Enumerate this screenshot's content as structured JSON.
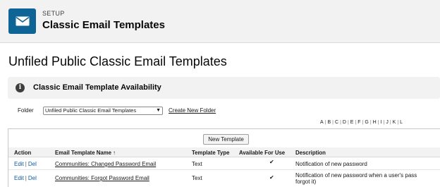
{
  "header": {
    "kicker": "SETUP",
    "title": "Classic Email Templates",
    "icon": "envelope-icon",
    "icon_bg": "#0e6595"
  },
  "page": {
    "heading": "Unfiled Public Classic Email Templates"
  },
  "availability": {
    "title": "Classic Email Template Availability",
    "icon": "info-icon"
  },
  "folder": {
    "label": "Folder",
    "selected": "Unfiled Public Classic Email Templates",
    "create_link": "Create New Folder"
  },
  "alpha_index": [
    "A",
    "B",
    "C",
    "D",
    "E",
    "F",
    "G",
    "H",
    "I",
    "J",
    "K",
    "L"
  ],
  "list": {
    "new_button": "New Template",
    "columns": {
      "action": "Action",
      "name": "Email Template Name",
      "sort_indicator": "↑",
      "type": "Template Type",
      "available": "Available For Use",
      "description": "Description"
    },
    "rows": [
      {
        "edit": "Edit",
        "sep": "|",
        "del": "Del",
        "name": "Communities: Changed Password Email",
        "type": "Text",
        "available": "✔",
        "description": "Notification of new password",
        "description_line2": ""
      },
      {
        "edit": "Edit",
        "sep": "|",
        "del": "Del",
        "name": "Communities: Forgot Password Email",
        "type": "Text",
        "available": "✔",
        "description": "Notification of new password when a user's pass",
        "description_line2": "forgot it)"
      }
    ]
  }
}
